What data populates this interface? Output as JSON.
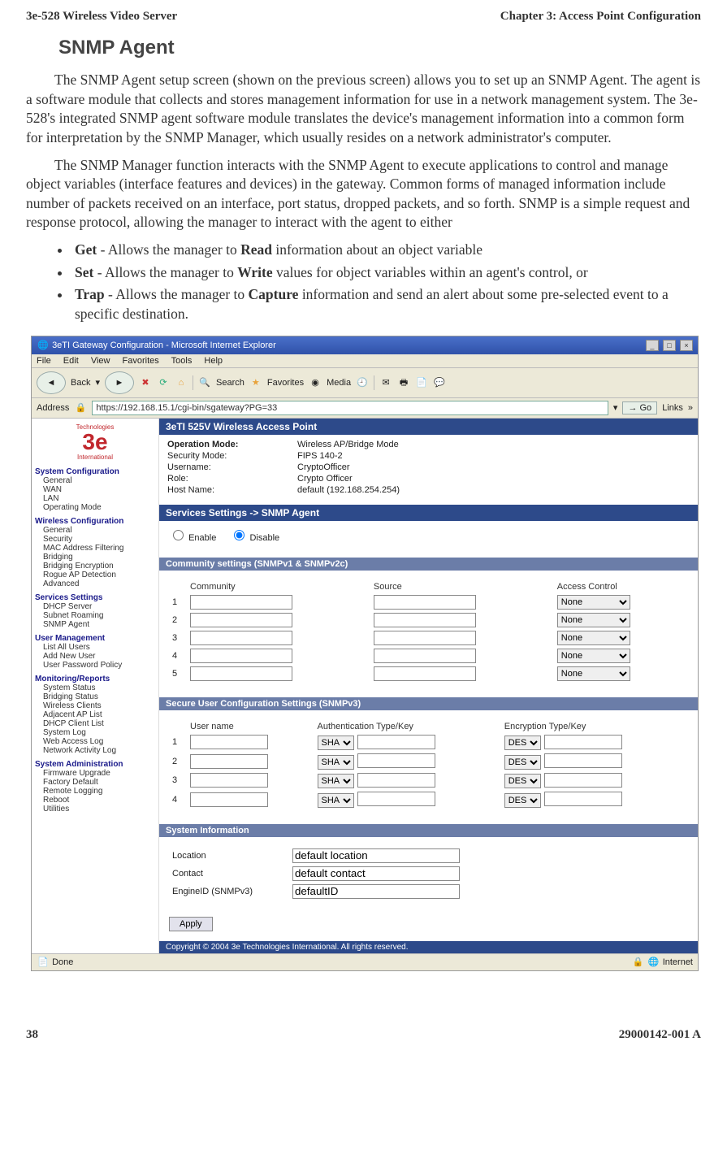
{
  "header": {
    "left": "3e-528 Wireless Video Server",
    "right": "Chapter 3: Access Point Configuration"
  },
  "title": "SNMP Agent",
  "para1": "The SNMP Agent setup screen (shown on the previous screen) allows you to set up an SNMP Agent. The agent is a software module that collects and stores management information for use in a network management system. The 3e-528's integrated SNMP agent software module translates the device's management information into a common form for interpretation by the SNMP Manager, which usually resides on a network administrator's computer.",
  "para2": "The SNMP Manager function interacts with the SNMP Agent to execute applications to control and manage object variables (interface features and devices) in the gateway. Common forms of managed information include number of packets received on an interface, port status, dropped packets, and so forth. SNMP is a simple request and response protocol, allowing the manager to interact with the agent to either",
  "bullets": {
    "get": {
      "term": "Get",
      "mid": " - Allows the manager to ",
      "bold": "Read",
      "tail": " information about an object variable"
    },
    "set": {
      "term": "Set",
      "mid": " - Allows the manager to ",
      "bold": "Write",
      "tail": " values for object variables within an agent's control, or"
    },
    "trap": {
      "term": "Trap",
      "mid": " - Allows the manager to ",
      "bold": "Capture",
      "tail": "  information and send an alert about some pre-selected event to a specific destination."
    }
  },
  "browser": {
    "title": "3eTI Gateway Configuration - Microsoft Internet Explorer",
    "menu": [
      "File",
      "Edit",
      "View",
      "Favorites",
      "Tools",
      "Help"
    ],
    "toolbar": {
      "back": "Back",
      "search": "Search",
      "favorites": "Favorites",
      "media": "Media"
    },
    "address_label": "Address",
    "address": "https://192.168.15.1/cgi-bin/sgateway?PG=33",
    "go": "Go",
    "links": "Links",
    "status_done": "Done",
    "status_zone": "Internet"
  },
  "leftnav": {
    "logo_top": "Technologies",
    "logo_bottom": "International",
    "groups": [
      {
        "title": "System Configuration",
        "items": [
          "General",
          "WAN",
          "LAN",
          "Operating Mode"
        ]
      },
      {
        "title": "Wireless Configuration",
        "items": [
          "General",
          "Security",
          "MAC Address Filtering",
          "Bridging",
          "Bridging Encryption",
          "Rogue AP Detection",
          "Advanced"
        ]
      },
      {
        "title": "Services Settings",
        "items": [
          "DHCP Server",
          "Subnet Roaming",
          "SNMP Agent"
        ]
      },
      {
        "title": "User Management",
        "items": [
          "List All Users",
          "Add New User",
          "User Password Policy"
        ]
      },
      {
        "title": "Monitoring/Reports",
        "items": [
          "System Status",
          "Bridging Status",
          "Wireless Clients",
          "Adjacent AP List",
          "DHCP Client List",
          "System Log",
          "Web Access Log",
          "Network Activity Log"
        ]
      },
      {
        "title": "System Administration",
        "items": [
          "Firmware Upgrade",
          "Factory Default",
          "Remote Logging",
          "Reboot",
          "Utilities"
        ]
      }
    ]
  },
  "panel": {
    "main_title": "3eTI 525V Wireless Access Point",
    "info": [
      {
        "label": "Operation Mode:",
        "value": "Wireless AP/Bridge Mode"
      },
      {
        "label": "Security Mode:",
        "value": "FIPS 140-2"
      },
      {
        "label": "Username:",
        "value": "CryptoOfficer"
      },
      {
        "label": "Role:",
        "value": "Crypto Officer"
      },
      {
        "label": "Host Name:",
        "value": "default (192.168.254.254)"
      }
    ],
    "section_title": "Services Settings -> SNMP Agent",
    "enable": "Enable",
    "disable": "Disable",
    "community_header": "Community settings (SNMPv1 & SNMPv2c)",
    "community_cols": [
      "",
      "Community",
      "Source",
      "Access Control"
    ],
    "community_rows": [
      "1",
      "2",
      "3",
      "4",
      "5"
    ],
    "access_option": "None",
    "secure_header": "Secure User Configuration Settings (SNMPv3)",
    "secure_cols": [
      "",
      "User name",
      "Authentication Type/Key",
      "Encryption Type/Key"
    ],
    "secure_rows": [
      "1",
      "2",
      "3",
      "4"
    ],
    "auth_option": "SHA",
    "enc_option": "DES",
    "sysinfo_header": "System Information",
    "sysinfo": {
      "location_label": "Location",
      "location_value": "default location",
      "contact_label": "Contact",
      "contact_value": "default contact",
      "engine_label": "EngineID (SNMPv3)",
      "engine_value": "defaultID"
    },
    "apply": "Apply",
    "copyright": "Copyright © 2004 3e Technologies International. All rights reserved."
  },
  "footer": {
    "left": "38",
    "right": "29000142-001 A"
  }
}
